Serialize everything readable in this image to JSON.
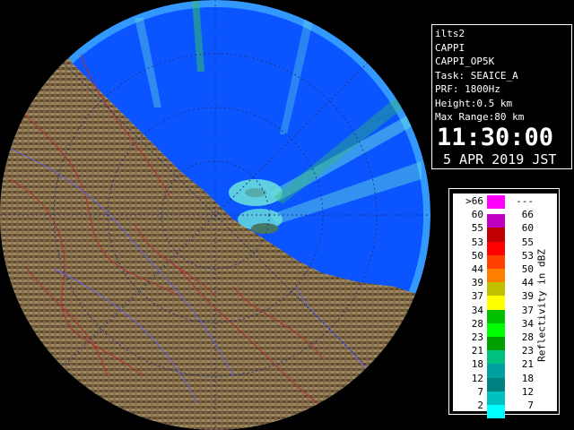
{
  "info": {
    "lines": [
      "ilts2",
      "CAPPI",
      "CAPPI_OP5K",
      "Task: SEAICE_A",
      "PRF: 1800Hz",
      "Height:0.5 km",
      "Max Range:80 km"
    ],
    "time": "11:30:00",
    "date": "5 APR 2019 JST"
  },
  "legend": {
    "unit_label": "Reflectivity in dBZ",
    "rows": [
      {
        "lower": ">66",
        "upper": "---",
        "color": "#ff00ff"
      },
      {
        "lower": "60",
        "upper": "66",
        "color": "#c000c0"
      },
      {
        "lower": "55",
        "upper": "60",
        "color": "#c00000"
      },
      {
        "lower": "53",
        "upper": "55",
        "color": "#ff0000"
      },
      {
        "lower": "50",
        "upper": "53",
        "color": "#ff4000"
      },
      {
        "lower": "44",
        "upper": "50",
        "color": "#ff8000"
      },
      {
        "lower": "39",
        "upper": "44",
        "color": "#c0c000"
      },
      {
        "lower": "37",
        "upper": "39",
        "color": "#ffff00"
      },
      {
        "lower": "34",
        "upper": "37",
        "color": "#00c000"
      },
      {
        "lower": "28",
        "upper": "34",
        "color": "#00ff00"
      },
      {
        "lower": "23",
        "upper": "28",
        "color": "#00a000"
      },
      {
        "lower": "21",
        "upper": "23",
        "color": "#00c080"
      },
      {
        "lower": "18",
        "upper": "21",
        "color": "#00a0a0"
      },
      {
        "lower": "12",
        "upper": "18",
        "color": "#008080"
      },
      {
        "lower": "7",
        "upper": "12",
        "color": "#00c0c0"
      },
      {
        "lower": "2",
        "upper": "7",
        "color": "#00ffff"
      }
    ]
  },
  "colors": {
    "sea": "#0a55ff",
    "sea_outer": "#3399ff",
    "land": "#7a6240",
    "echo_light": "#66dddd",
    "echo_green": "#33bb66"
  }
}
